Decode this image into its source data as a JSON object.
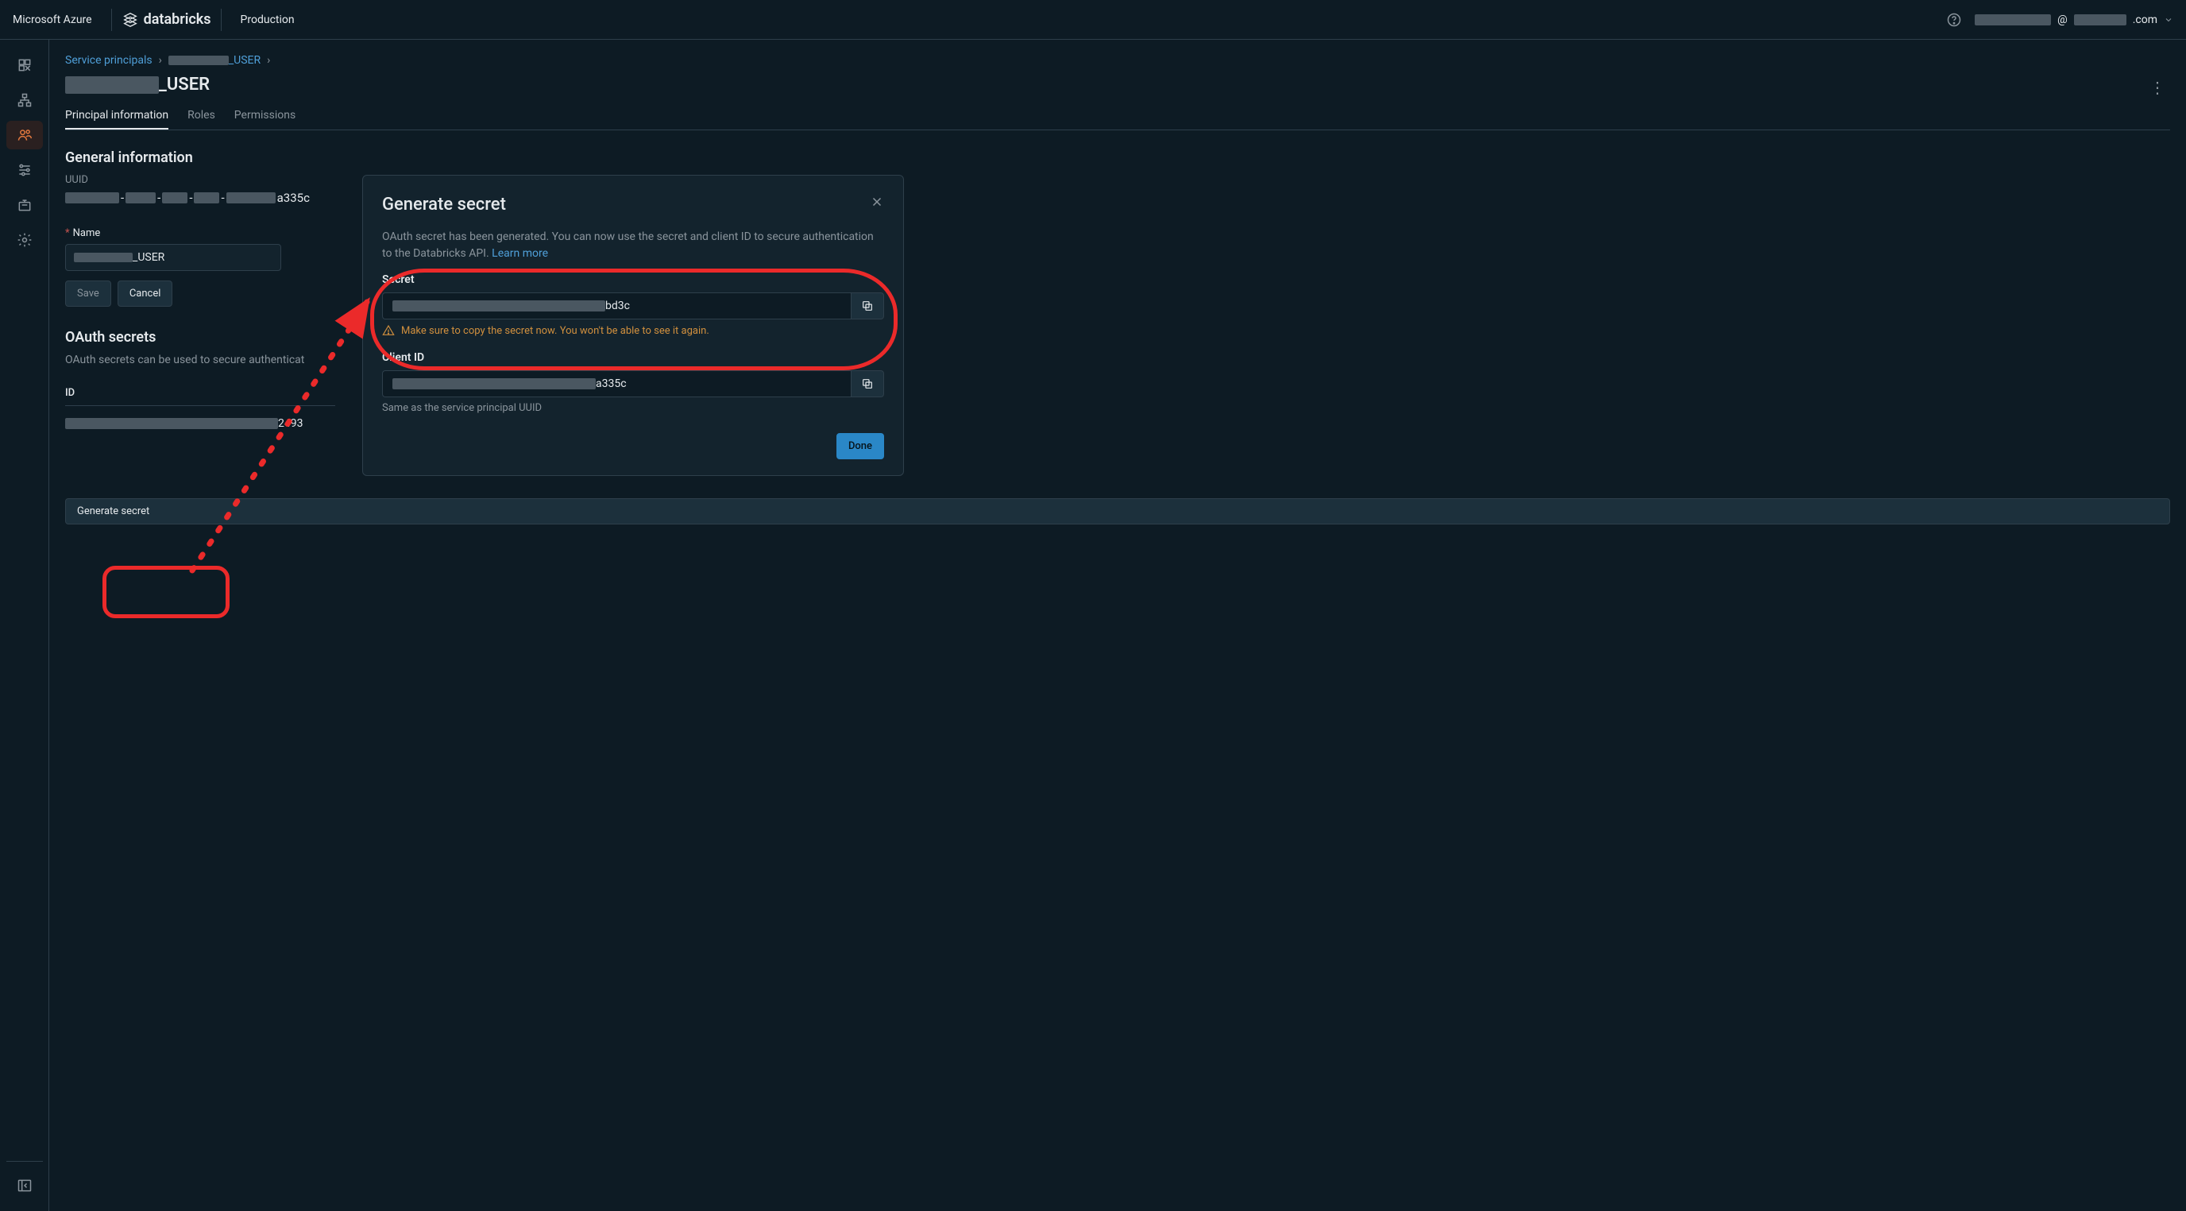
{
  "header": {
    "azure": "Microsoft Azure",
    "databricks": "databricks",
    "env": "Production",
    "email_mid": "@",
    "email_tail": ".com"
  },
  "breadcrumbs": {
    "root": "Service principals",
    "current_suffix": "_USER"
  },
  "page": {
    "title_suffix": "_USER"
  },
  "tabs": {
    "principal": "Principal information",
    "roles": "Roles",
    "permissions": "Permissions"
  },
  "general": {
    "heading": "General information",
    "uuid_label": "UUID",
    "uuid_tail": "a335c",
    "name_label": "Name",
    "name_value_suffix": "_USER",
    "save": "Save",
    "cancel": "Cancel"
  },
  "oauth": {
    "heading": "OAuth secrets",
    "desc_prefix": "OAuth secrets can be used to secure authenticat",
    "col_id": "ID",
    "row_tail": "2493",
    "generate": "Generate secret"
  },
  "modal": {
    "title": "Generate secret",
    "desc": "OAuth secret has been generated. You can now use the secret and client ID to secure authentication to the Databricks API.",
    "learn_more": "Learn more",
    "secret_label": "Secret",
    "secret_tail": "bd3c",
    "warn": "Make sure to copy the secret now. You won't be able to see it again.",
    "client_label": "Client ID",
    "client_tail": "a335c",
    "client_hint": "Same as the service principal UUID",
    "done": "Done"
  }
}
